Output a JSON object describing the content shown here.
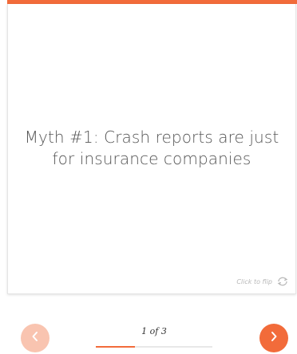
{
  "card": {
    "text": "Myth #1: Crash reports are just for insurance companies",
    "flip_label": "Click to flip",
    "flip_icon": "refresh-icon"
  },
  "pager": {
    "text": "1 of 3",
    "current": 1,
    "total": 3
  },
  "nav": {
    "prev_icon": "chevron-left-icon",
    "next_icon": "chevron-right-icon"
  },
  "colors": {
    "accent": "#f26b3a",
    "accent_disabled": "#f9c4b0",
    "card_text": "#555555",
    "hint_text": "#b8b8b8"
  }
}
